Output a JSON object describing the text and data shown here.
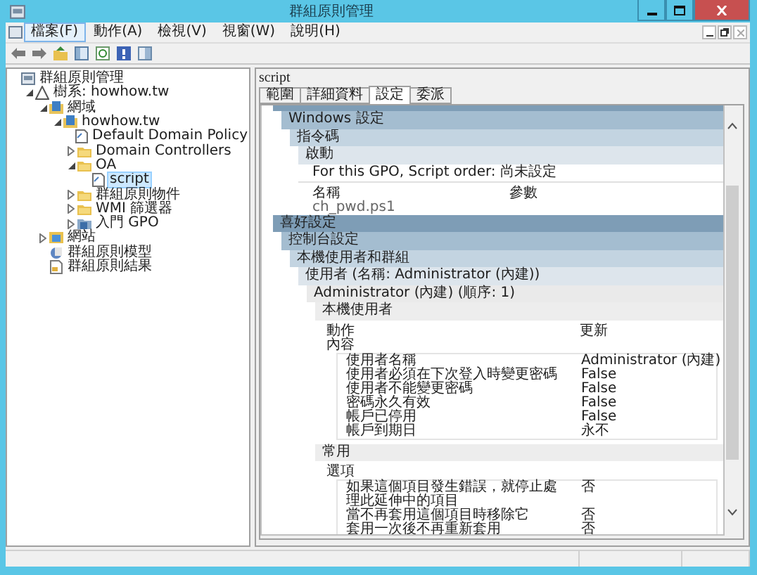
{
  "window": {
    "title": "群組原則管理"
  },
  "menu": [
    {
      "label": "檔案(F)",
      "selected": true
    },
    {
      "label": "動作(A)",
      "selected": false
    },
    {
      "label": "檢視(V)",
      "selected": false
    },
    {
      "label": "視窗(W)",
      "selected": false
    },
    {
      "label": "說明(H)",
      "selected": false
    }
  ],
  "tree": [
    {
      "label": "群組原則管理",
      "kind": "root",
      "selected": false,
      "children": [
        {
          "label": "樹系: howhow.tw",
          "kind": "forest",
          "expanded": true,
          "selected": false,
          "children": [
            {
              "label": "網域",
              "kind": "domains",
              "expanded": true,
              "selected": false,
              "children": [
                {
                  "label": "howhow.tw",
                  "kind": "domain",
                  "expanded": true,
                  "selected": false,
                  "children": [
                    {
                      "label": "Default Domain Policy",
                      "kind": "gpo",
                      "selected": false
                    },
                    {
                      "label": "Domain Controllers",
                      "kind": "ou",
                      "expanded": false,
                      "selected": false
                    },
                    {
                      "label": "OA",
                      "kind": "ou",
                      "expanded": true,
                      "selected": false,
                      "children": [
                        {
                          "label": "script",
                          "kind": "gpo",
                          "selected": true
                        }
                      ]
                    },
                    {
                      "label": "群組原則物件",
                      "kind": "ou",
                      "expanded": false,
                      "selected": false
                    },
                    {
                      "label": "WMI 篩選器",
                      "kind": "ou",
                      "expanded": false,
                      "selected": false
                    },
                    {
                      "label": "入門 GPO",
                      "kind": "starter",
                      "expanded": false,
                      "selected": false
                    }
                  ]
                }
              ]
            },
            {
              "label": "網站",
              "kind": "sites",
              "expanded": false,
              "selected": false
            },
            {
              "label": "群組原則模型",
              "kind": "modeling",
              "selected": false
            },
            {
              "label": "群組原則結果",
              "kind": "results",
              "selected": false
            }
          ]
        }
      ]
    }
  ],
  "detail": {
    "title": "script",
    "tabs": [
      {
        "label": "範圍",
        "selected": false
      },
      {
        "label": "詳細資料",
        "selected": false
      },
      {
        "label": "設定",
        "selected": true
      },
      {
        "label": "委派",
        "selected": false
      }
    ],
    "report": [
      {
        "children": [
          {
            "title": "Windows 設定",
            "children": [
              {
                "title": "指令碼",
                "children": [
                  {
                    "title": "啟動",
                    "body": {
                      "kind": "script",
                      "note": "For this GPO, Script order: 尚未設定",
                      "columns": [
                        "名稱",
                        "參數"
                      ],
                      "rows": [
                        [
                          "ch_pwd.ps1"
                        ]
                      ]
                    }
                  }
                ]
              }
            ]
          }
        ]
      },
      {
        "title": "喜好設定",
        "children": [
          {
            "title": "控制台設定",
            "children": [
              {
                "title": "本機使用者和群組",
                "children": [
                  {
                    "title": "使用者 (名稱: Administrator (內建))",
                    "children": [
                      {
                        "title": "Administrator (內建) (順序: 1)",
                        "children": [
                          {
                            "title": "本機使用者",
                            "body": {
                              "kind": "properties",
                              "fields": [
                                {
                                  "label": "動作",
                                  "value": "更新"
                                }
                              ],
                              "group_label": "內容",
                              "rows": [
                                {
                                  "label": "使用者名稱",
                                  "value": "Administrator (內建)"
                                },
                                {
                                  "label": "使用者必須在下次登入時變更密碼",
                                  "value": "False"
                                },
                                {
                                  "label": "使用者不能變更密碼",
                                  "value": "False"
                                },
                                {
                                  "label": "密碼永久有效",
                                  "value": "False"
                                },
                                {
                                  "label": "帳戶已停用",
                                  "value": "False"
                                },
                                {
                                  "label": "帳戶到期日",
                                  "value": "永不"
                                }
                              ]
                            }
                          },
                          {
                            "title": "常用",
                            "body": {
                              "kind": "properties",
                              "group_label": "選項",
                              "rows": [
                                {
                                  "label": "如果這個項目發生錯誤，就停止處理此延伸中的項目",
                                  "value": "否"
                                },
                                {
                                  "label": "當不再套用這個項目時移除它",
                                  "value": "否"
                                },
                                {
                                  "label": "套用一次後不再重新套用",
                                  "value": "否"
                                }
                              ]
                            }
                          }
                        ]
                      }
                    ]
                  }
                ]
              }
            ]
          }
        ]
      }
    ]
  }
}
